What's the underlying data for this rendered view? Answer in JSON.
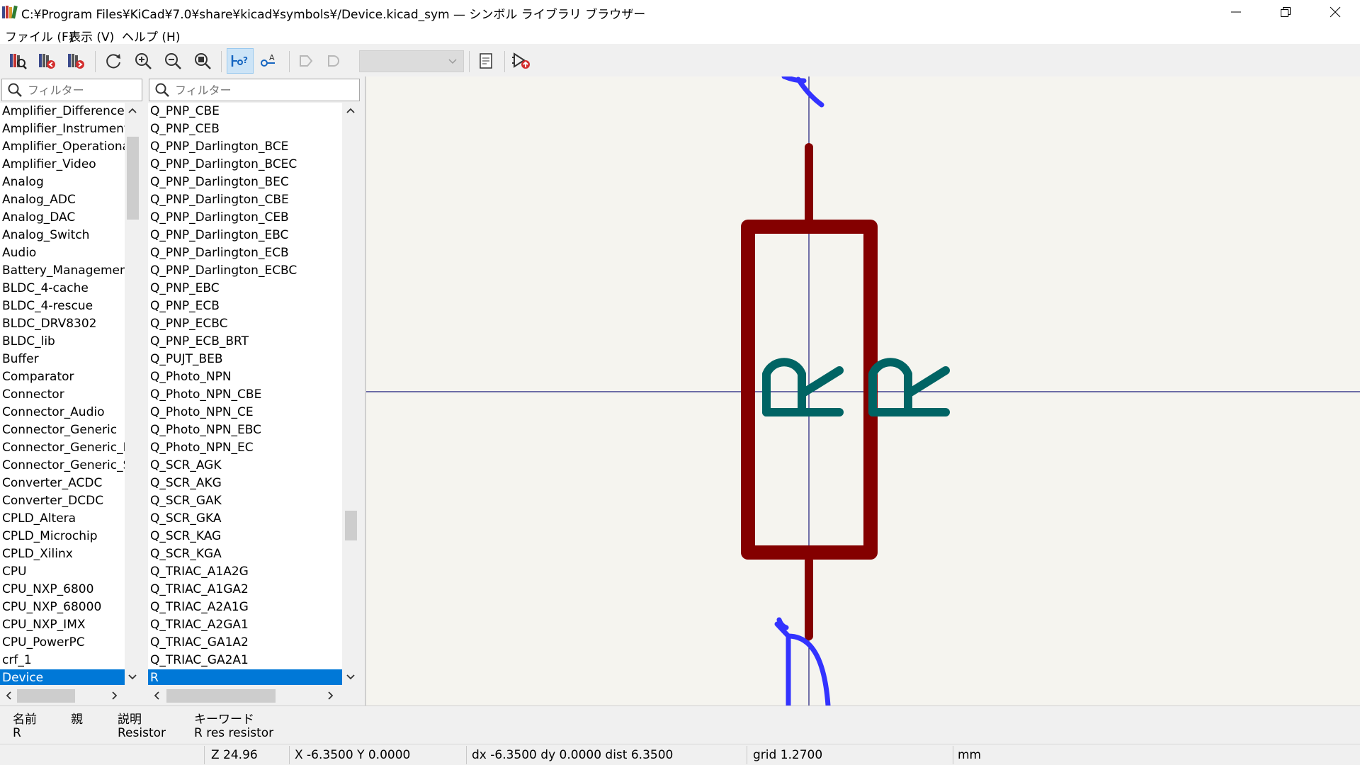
{
  "window": {
    "title": "C:¥Program Files¥KiCad¥7.0¥share¥kicad¥symbols¥/Device.kicad_sym — シンボル ライブラリ ブラウザー"
  },
  "menu": [
    "ファイル (F)",
    "表示 (V)",
    "ヘルプ (H)"
  ],
  "toolbar": {
    "icons": [
      "select-library-icon",
      "previous-symbol-icon",
      "next-symbol-icon",
      "refresh-icon",
      "zoom-in-icon",
      "zoom-out-icon",
      "zoom-fit-icon",
      "show-pin-electrical-type-icon",
      "show-pin-numbers-icon",
      "body-style-1-icon",
      "body-style-2-icon",
      "unit-select-combo",
      "view-datasheet-icon",
      "add-symbol-to-schematic-icon"
    ]
  },
  "library_filter": {
    "placeholder": "フィルター"
  },
  "symbol_filter": {
    "placeholder": "フィルター"
  },
  "libraries": [
    "Amplifier_Difference",
    "Amplifier_Instrumentation",
    "Amplifier_Operational",
    "Amplifier_Video",
    "Analog",
    "Analog_ADC",
    "Analog_DAC",
    "Analog_Switch",
    "Audio",
    "Battery_Management",
    "BLDC_4-cache",
    "BLDC_4-rescue",
    "BLDC_DRV8302",
    "BLDC_lib",
    "Buffer",
    "Comparator",
    "Connector",
    "Connector_Audio",
    "Connector_Generic",
    "Connector_Generic_MountingPin",
    "Connector_Generic_Shielded",
    "Converter_ACDC",
    "Converter_DCDC",
    "CPLD_Altera",
    "CPLD_Microchip",
    "CPLD_Xilinx",
    "CPU",
    "CPU_NXP_6800",
    "CPU_NXP_68000",
    "CPU_NXP_IMX",
    "CPU_PowerPC",
    "crf_1",
    "Device"
  ],
  "selected_library": "Device",
  "symbols": [
    "Q_PNP_CBE",
    "Q_PNP_CEB",
    "Q_PNP_Darlington_BCE",
    "Q_PNP_Darlington_BCEC",
    "Q_PNP_Darlington_BEC",
    "Q_PNP_Darlington_CBE",
    "Q_PNP_Darlington_CEB",
    "Q_PNP_Darlington_EBC",
    "Q_PNP_Darlington_ECB",
    "Q_PNP_Darlington_ECBC",
    "Q_PNP_EBC",
    "Q_PNP_ECB",
    "Q_PNP_ECBC",
    "Q_PNP_ECB_BRT",
    "Q_PUJT_BEB",
    "Q_Photo_NPN",
    "Q_Photo_NPN_CBE",
    "Q_Photo_NPN_CE",
    "Q_Photo_NPN_EBC",
    "Q_Photo_NPN_EC",
    "Q_SCR_AGK",
    "Q_SCR_AKG",
    "Q_SCR_GAK",
    "Q_SCR_GKA",
    "Q_SCR_KAG",
    "Q_SCR_KGA",
    "Q_TRIAC_A1A2G",
    "Q_TRIAC_A1GA2",
    "Q_TRIAC_A2A1G",
    "Q_TRIAC_A2GA1",
    "Q_TRIAC_GA1A2",
    "Q_TRIAC_GA2A1",
    "R"
  ],
  "selected_symbol": "R",
  "symbol_preview": {
    "reference": "R",
    "value": "R",
    "colors": {
      "body": "#840000",
      "text": "#006464",
      "pin_number": "#3333ff",
      "background": "#f5f4ef",
      "crosshair": "#1a1a7a"
    }
  },
  "info": {
    "headers": {
      "name": "名前",
      "parent": "親",
      "description": "説明",
      "keywords": "キーワード"
    },
    "values": {
      "name": "R",
      "parent": "",
      "description": "Resistor",
      "keywords": "R res resistor"
    }
  },
  "status": {
    "zoom": "Z 24.96",
    "cursor": "X -6.3500  Y 0.0000",
    "delta": "dx -6.3500  dy 0.0000  dist 6.3500",
    "grid": "grid 1.2700",
    "units": "mm"
  }
}
